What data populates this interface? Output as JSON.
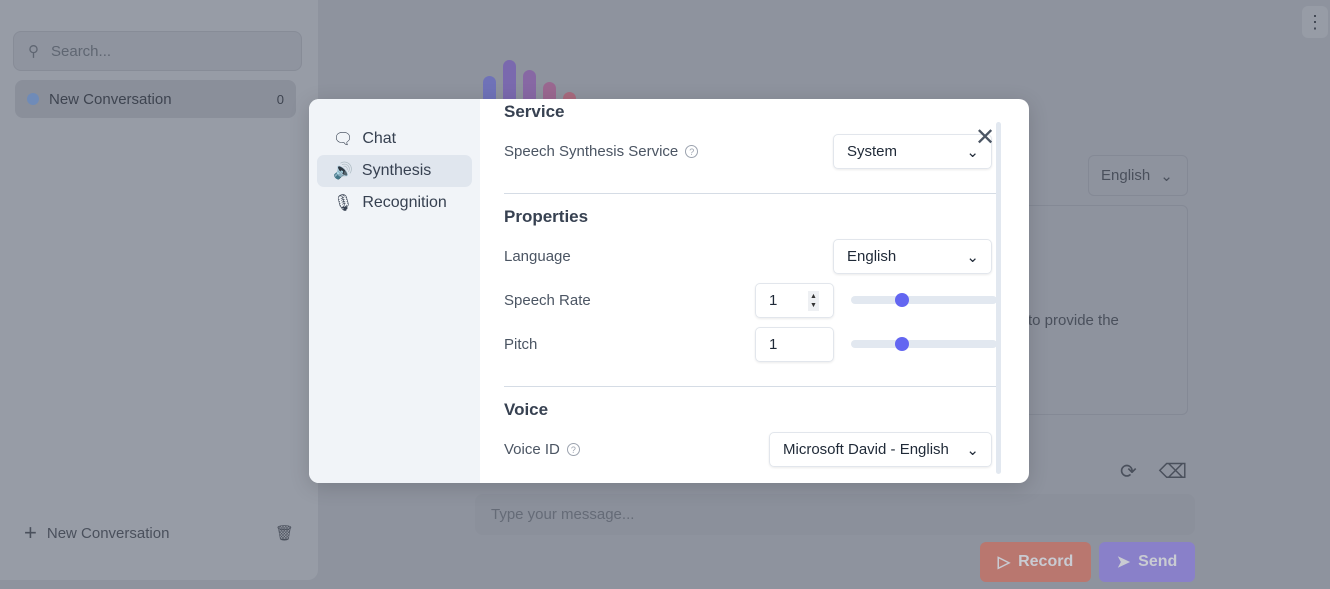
{
  "sidebar": {
    "search_placeholder": "Search...",
    "conversations": [
      {
        "title": "New Conversation",
        "count": "0"
      }
    ],
    "new_conversation_label": "New Conversation"
  },
  "main": {
    "language": "English",
    "response_fragment": "to provide the",
    "message_placeholder": "Type your message...",
    "record_label": "Record",
    "send_label": "Send"
  },
  "colors": {
    "record": "#f26d5b",
    "send": "#7c6cf2",
    "accent": "#6366f1"
  },
  "modal": {
    "nav": [
      {
        "label": "Chat",
        "icon": "chat-bubble-icon"
      },
      {
        "label": "Synthesis",
        "icon": "speaker-icon",
        "active": true
      },
      {
        "label": "Recognition",
        "icon": "microphone-icon"
      }
    ],
    "service": {
      "heading": "Service",
      "service_label": "Speech Synthesis Service",
      "service_value": "System"
    },
    "properties": {
      "heading": "Properties",
      "language_label": "Language",
      "language_value": "English",
      "rate_label": "Speech Rate",
      "rate_value": "1",
      "rate_slider_fraction": 0.35,
      "pitch_label": "Pitch",
      "pitch_value": "1",
      "pitch_slider_fraction": 0.35
    },
    "voice": {
      "heading": "Voice",
      "voice_label": "Voice ID",
      "voice_value": "Microsoft David - English"
    }
  }
}
